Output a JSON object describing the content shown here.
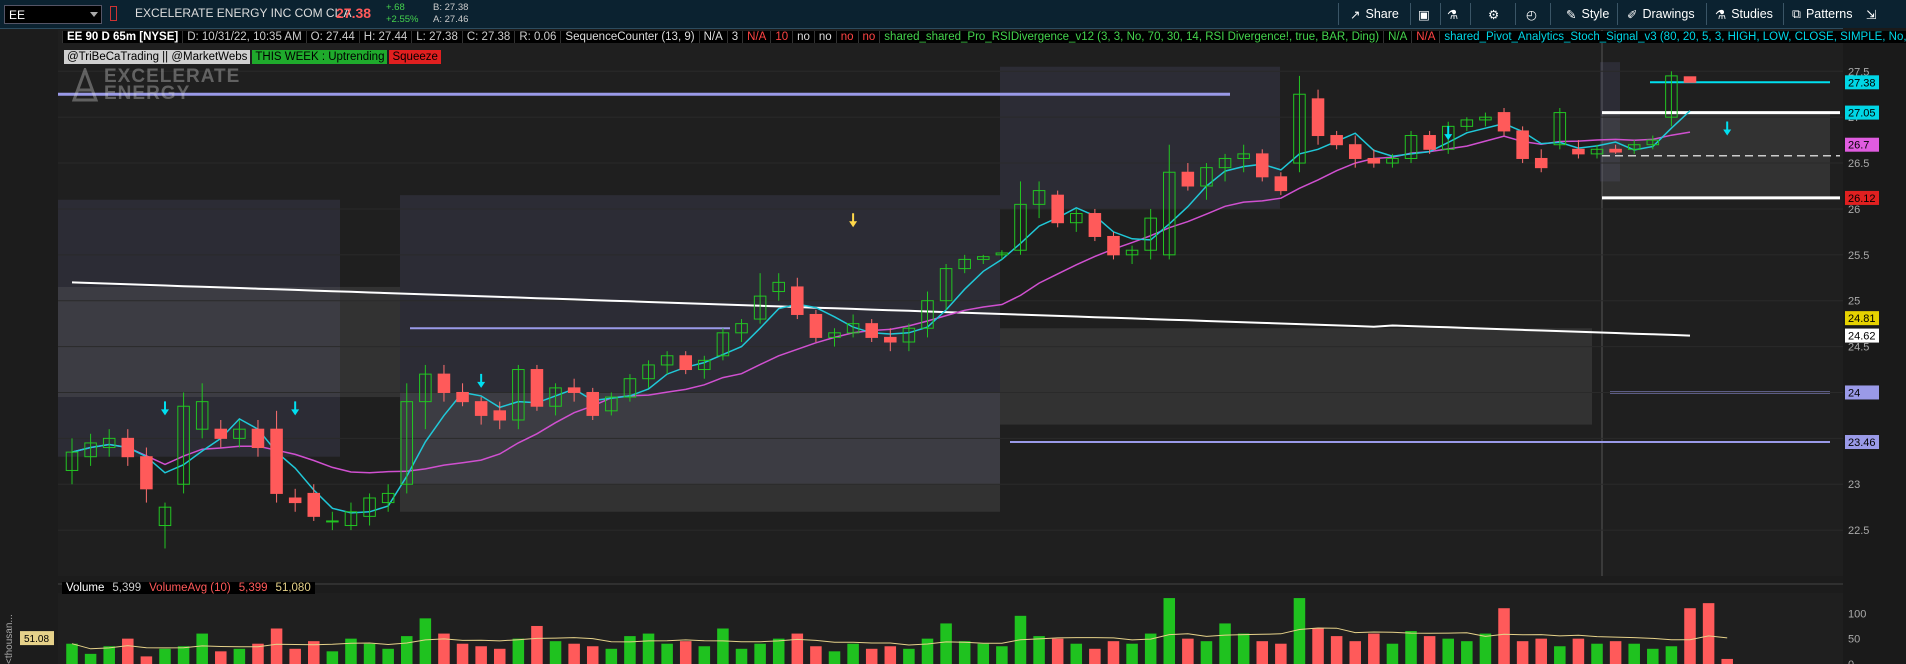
{
  "toolbar": {
    "symbol": "EE",
    "company": "EXCELERATE ENERGY INC COM CL A",
    "last_price": "27.38",
    "change": "+.68",
    "change_pct": "+2.55%",
    "bid": "B: 27.38",
    "ask": "A: 27.46",
    "share_label": "Share",
    "style_label": "Style",
    "drawings_label": "Drawings",
    "studies_label": "Studies",
    "patterns_label": "Patterns"
  },
  "infobar": {
    "title": "EE 90 D 65m [NYSE]",
    "date": "D: 10/31/22, 10:35 AM",
    "open": "O: 27.44",
    "high": "H: 27.44",
    "low": "L: 27.38",
    "close": "C: 27.38",
    "range": "R: 0.06",
    "seq_counter": "SequenceCounter (13, 9)",
    "na1": "N/A",
    "n3": "3",
    "na2": "N/A",
    "n10": "10",
    "no1": "no",
    "no2": "no",
    "no3": "no",
    "no4": "no",
    "rsi_div": "shared_shared_Pro_RSIDivergence_v12 (3, 3, No, 70, 30, 14, RSI Divergence!, true, BAR, Ding)",
    "na3": "N/A",
    "na4": "N/A",
    "pivot": "shared_Pivot_Analytics_Stoch_Signal_v3 (80, 20, 5, 3, HIGH, LOW, CLOSE, SIMPLE, No,..."
  },
  "badges": {
    "handle": "@TriBeCaTrading || @MarketWebs",
    "trend": "THIS WEEK : Uptrending",
    "squeeze": "Squeeze"
  },
  "logo": {
    "line1": "EXCELERATE",
    "line2": "ENERGY"
  },
  "volume_bar": {
    "label": "Volume",
    "value": "5,399",
    "avg_label": "VolumeAvg (10)",
    "avg_value": "5,399",
    "avg_value2": "51,080",
    "side_marker": "51.08",
    "unit_label": "<thousan..."
  },
  "price_axis": {
    "ticks": [
      "27.5",
      "27",
      "26.5",
      "26",
      "25.5",
      "25",
      "24.5",
      "24",
      "23.5",
      "23",
      "22.5"
    ],
    "markers": [
      {
        "text": "27.38",
        "color": "#00d6e6"
      },
      {
        "text": "27.05",
        "color": "#00d6e6"
      },
      {
        "text": "26.7",
        "color": "#e05ce0"
      },
      {
        "text": "26.12",
        "color": "#e02020"
      },
      {
        "text": "24.81",
        "color": "#e6d200"
      },
      {
        "text": "24.62",
        "color": "#ffffff"
      },
      {
        "text": "24",
        "color": "#9a9ae8"
      },
      {
        "text": "23.46",
        "color": "#9a9ae8"
      }
    ]
  },
  "volume_axis": {
    "ticks": [
      "100",
      "50",
      "0"
    ]
  },
  "chart_data": {
    "type": "candlestick",
    "symbol": "EE",
    "timeframe": "90 D 65m",
    "ylim": [
      22,
      27.95
    ],
    "candles": [
      {
        "o": 23.15,
        "h": 23.5,
        "l": 23.0,
        "c": 23.35
      },
      {
        "o": 23.3,
        "h": 23.55,
        "l": 23.2,
        "c": 23.45
      },
      {
        "o": 23.4,
        "h": 23.6,
        "l": 23.3,
        "c": 23.5
      },
      {
        "o": 23.5,
        "h": 23.6,
        "l": 23.2,
        "c": 23.3
      },
      {
        "o": 23.3,
        "h": 23.4,
        "l": 22.8,
        "c": 22.95
      },
      {
        "o": 22.55,
        "h": 22.8,
        "l": 22.3,
        "c": 22.75
      },
      {
        "o": 23.0,
        "h": 24.0,
        "l": 22.9,
        "c": 23.85
      },
      {
        "o": 23.6,
        "h": 24.1,
        "l": 23.5,
        "c": 23.9
      },
      {
        "o": 23.6,
        "h": 23.7,
        "l": 23.4,
        "c": 23.5
      },
      {
        "o": 23.5,
        "h": 23.7,
        "l": 23.4,
        "c": 23.6
      },
      {
        "o": 23.6,
        "h": 23.7,
        "l": 23.3,
        "c": 23.4
      },
      {
        "o": 23.6,
        "h": 23.8,
        "l": 22.8,
        "c": 22.9
      },
      {
        "o": 22.85,
        "h": 22.95,
        "l": 22.7,
        "c": 22.8
      },
      {
        "o": 22.9,
        "h": 23.0,
        "l": 22.6,
        "c": 22.65
      },
      {
        "o": 22.6,
        "h": 22.7,
        "l": 22.5,
        "c": 22.6
      },
      {
        "o": 22.55,
        "h": 22.8,
        "l": 22.5,
        "c": 22.7
      },
      {
        "o": 22.65,
        "h": 22.9,
        "l": 22.55,
        "c": 22.85
      },
      {
        "o": 22.8,
        "h": 23.0,
        "l": 22.7,
        "c": 22.9
      },
      {
        "o": 23.0,
        "h": 24.1,
        "l": 22.9,
        "c": 23.9
      },
      {
        "o": 23.9,
        "h": 24.3,
        "l": 23.6,
        "c": 24.2
      },
      {
        "o": 24.2,
        "h": 24.3,
        "l": 23.9,
        "c": 24.0
      },
      {
        "o": 24.0,
        "h": 24.1,
        "l": 23.85,
        "c": 23.9
      },
      {
        "o": 23.9,
        "h": 23.95,
        "l": 23.65,
        "c": 23.75
      },
      {
        "o": 23.8,
        "h": 23.9,
        "l": 23.6,
        "c": 23.7
      },
      {
        "o": 23.7,
        "h": 24.3,
        "l": 23.6,
        "c": 24.25
      },
      {
        "o": 24.25,
        "h": 24.3,
        "l": 23.8,
        "c": 23.85
      },
      {
        "o": 23.85,
        "h": 24.1,
        "l": 23.75,
        "c": 24.05
      },
      {
        "o": 24.05,
        "h": 24.15,
        "l": 23.9,
        "c": 24.0
      },
      {
        "o": 24.0,
        "h": 24.05,
        "l": 23.7,
        "c": 23.75
      },
      {
        "o": 23.8,
        "h": 24.0,
        "l": 23.75,
        "c": 23.95
      },
      {
        "o": 23.95,
        "h": 24.2,
        "l": 23.9,
        "c": 24.15
      },
      {
        "o": 24.15,
        "h": 24.35,
        "l": 24.05,
        "c": 24.3
      },
      {
        "o": 24.3,
        "h": 24.45,
        "l": 24.2,
        "c": 24.4
      },
      {
        "o": 24.4,
        "h": 24.45,
        "l": 24.2,
        "c": 24.25
      },
      {
        "o": 24.25,
        "h": 24.4,
        "l": 24.15,
        "c": 24.35
      },
      {
        "o": 24.4,
        "h": 24.7,
        "l": 24.35,
        "c": 24.65
      },
      {
        "o": 24.65,
        "h": 24.8,
        "l": 24.55,
        "c": 24.75
      },
      {
        "o": 24.8,
        "h": 25.3,
        "l": 24.75,
        "c": 25.05
      },
      {
        "o": 25.1,
        "h": 25.3,
        "l": 25.0,
        "c": 25.2
      },
      {
        "o": 25.15,
        "h": 25.25,
        "l": 24.8,
        "c": 24.85
      },
      {
        "o": 24.85,
        "h": 24.9,
        "l": 24.55,
        "c": 24.6
      },
      {
        "o": 24.6,
        "h": 24.7,
        "l": 24.5,
        "c": 24.65
      },
      {
        "o": 24.65,
        "h": 24.85,
        "l": 24.6,
        "c": 24.75
      },
      {
        "o": 24.75,
        "h": 24.8,
        "l": 24.55,
        "c": 24.6
      },
      {
        "o": 24.6,
        "h": 24.7,
        "l": 24.45,
        "c": 24.55
      },
      {
        "o": 24.55,
        "h": 24.75,
        "l": 24.45,
        "c": 24.7
      },
      {
        "o": 24.7,
        "h": 25.1,
        "l": 24.6,
        "c": 25.0
      },
      {
        "o": 25.0,
        "h": 25.4,
        "l": 24.9,
        "c": 25.35
      },
      {
        "o": 25.35,
        "h": 25.5,
        "l": 25.3,
        "c": 25.45
      },
      {
        "o": 25.45,
        "h": 25.5,
        "l": 25.4,
        "c": 25.48
      },
      {
        "o": 25.5,
        "h": 25.55,
        "l": 25.45,
        "c": 25.52
      },
      {
        "o": 25.55,
        "h": 26.3,
        "l": 25.5,
        "c": 26.05
      },
      {
        "o": 26.05,
        "h": 26.3,
        "l": 25.9,
        "c": 26.2
      },
      {
        "o": 26.15,
        "h": 26.2,
        "l": 25.8,
        "c": 25.85
      },
      {
        "o": 25.85,
        "h": 26.0,
        "l": 25.75,
        "c": 25.95
      },
      {
        "o": 25.95,
        "h": 26.0,
        "l": 25.65,
        "c": 25.7
      },
      {
        "o": 25.7,
        "h": 25.75,
        "l": 25.45,
        "c": 25.5
      },
      {
        "o": 25.5,
        "h": 25.6,
        "l": 25.4,
        "c": 25.55
      },
      {
        "o": 25.55,
        "h": 26.0,
        "l": 25.45,
        "c": 25.9
      },
      {
        "o": 25.5,
        "h": 26.7,
        "l": 25.45,
        "c": 26.4
      },
      {
        "o": 26.4,
        "h": 26.5,
        "l": 26.2,
        "c": 26.25
      },
      {
        "o": 26.25,
        "h": 26.5,
        "l": 26.1,
        "c": 26.45
      },
      {
        "o": 26.45,
        "h": 26.6,
        "l": 26.3,
        "c": 26.55
      },
      {
        "o": 26.55,
        "h": 26.7,
        "l": 26.4,
        "c": 26.6
      },
      {
        "o": 26.6,
        "h": 26.65,
        "l": 26.3,
        "c": 26.35
      },
      {
        "o": 26.35,
        "h": 26.4,
        "l": 26.15,
        "c": 26.2
      },
      {
        "o": 26.5,
        "h": 27.45,
        "l": 26.4,
        "c": 27.25
      },
      {
        "o": 27.2,
        "h": 27.3,
        "l": 26.7,
        "c": 26.8
      },
      {
        "o": 26.8,
        "h": 26.85,
        "l": 26.65,
        "c": 26.7
      },
      {
        "o": 26.7,
        "h": 26.8,
        "l": 26.45,
        "c": 26.55
      },
      {
        "o": 26.55,
        "h": 26.65,
        "l": 26.45,
        "c": 26.5
      },
      {
        "o": 26.5,
        "h": 26.6,
        "l": 26.45,
        "c": 26.55
      },
      {
        "o": 26.55,
        "h": 26.85,
        "l": 26.5,
        "c": 26.8
      },
      {
        "o": 26.8,
        "h": 26.85,
        "l": 26.6,
        "c": 26.65
      },
      {
        "o": 26.65,
        "h": 26.95,
        "l": 26.6,
        "c": 26.9
      },
      {
        "o": 26.9,
        "h": 27.0,
        "l": 26.85,
        "c": 26.97
      },
      {
        "o": 26.97,
        "h": 27.05,
        "l": 26.9,
        "c": 27.0
      },
      {
        "o": 27.05,
        "h": 27.1,
        "l": 26.8,
        "c": 26.85
      },
      {
        "o": 26.85,
        "h": 26.9,
        "l": 26.5,
        "c": 26.55
      },
      {
        "o": 26.55,
        "h": 26.65,
        "l": 26.4,
        "c": 26.45
      },
      {
        "o": 26.7,
        "h": 27.1,
        "l": 26.65,
        "c": 27.05
      },
      {
        "o": 26.65,
        "h": 26.75,
        "l": 26.55,
        "c": 26.6
      },
      {
        "o": 26.6,
        "h": 26.7,
        "l": 26.55,
        "c": 26.65
      },
      {
        "o": 26.65,
        "h": 26.7,
        "l": 26.6,
        "c": 26.62
      },
      {
        "o": 26.65,
        "h": 26.75,
        "l": 26.6,
        "c": 26.7
      },
      {
        "o": 26.7,
        "h": 26.8,
        "l": 26.65,
        "c": 26.75
      },
      {
        "o": 27.0,
        "h": 27.5,
        "l": 26.9,
        "c": 27.45
      },
      {
        "o": 27.44,
        "h": 27.44,
        "l": 27.38,
        "c": 27.38
      }
    ],
    "volume": [
      40,
      20,
      35,
      50,
      15,
      30,
      35,
      60,
      25,
      30,
      40,
      70,
      30,
      45,
      25,
      50,
      40,
      30,
      55,
      90,
      60,
      40,
      35,
      30,
      50,
      75,
      45,
      40,
      35,
      30,
      55,
      60,
      40,
      45,
      35,
      70,
      30,
      40,
      50,
      60,
      35,
      25,
      40,
      30,
      35,
      30,
      50,
      80,
      45,
      40,
      35,
      95,
      55,
      50,
      40,
      30,
      45,
      40,
      60,
      130,
      50,
      45,
      80,
      60,
      45,
      40,
      130,
      70,
      55,
      45,
      60,
      40,
      65,
      55,
      50,
      45,
      60,
      110,
      45,
      50,
      35,
      50,
      40,
      45,
      40,
      30,
      35,
      110,
      120,
      10
    ],
    "volume_ylim": [
      0,
      140
    ]
  }
}
